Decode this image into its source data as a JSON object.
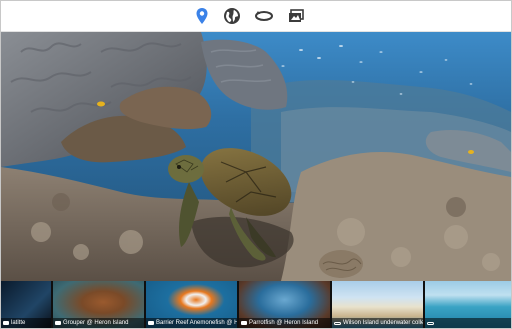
{
  "toolbar": {
    "icons": [
      "map-pin-icon",
      "globe-icon",
      "360-view-icon",
      "photo-gallery-icon"
    ],
    "accent_color": "#3b82e8",
    "icon_color": "#3c3c3c"
  },
  "scene": {
    "subject": "green-sea-turtle"
  },
  "thumbnails": [
    {
      "label": "latitte",
      "type": "photo"
    },
    {
      "label": "Grouper @ Heron Island",
      "type": "photo"
    },
    {
      "label": "Barrier Reef Anemonefish @ Hero...",
      "type": "photo"
    },
    {
      "label": "Parrotfish @ Heron Island",
      "type": "photo"
    },
    {
      "label": "Wilson Island underwater collect",
      "type": "pano"
    },
    {
      "label": "",
      "type": "pano"
    }
  ]
}
